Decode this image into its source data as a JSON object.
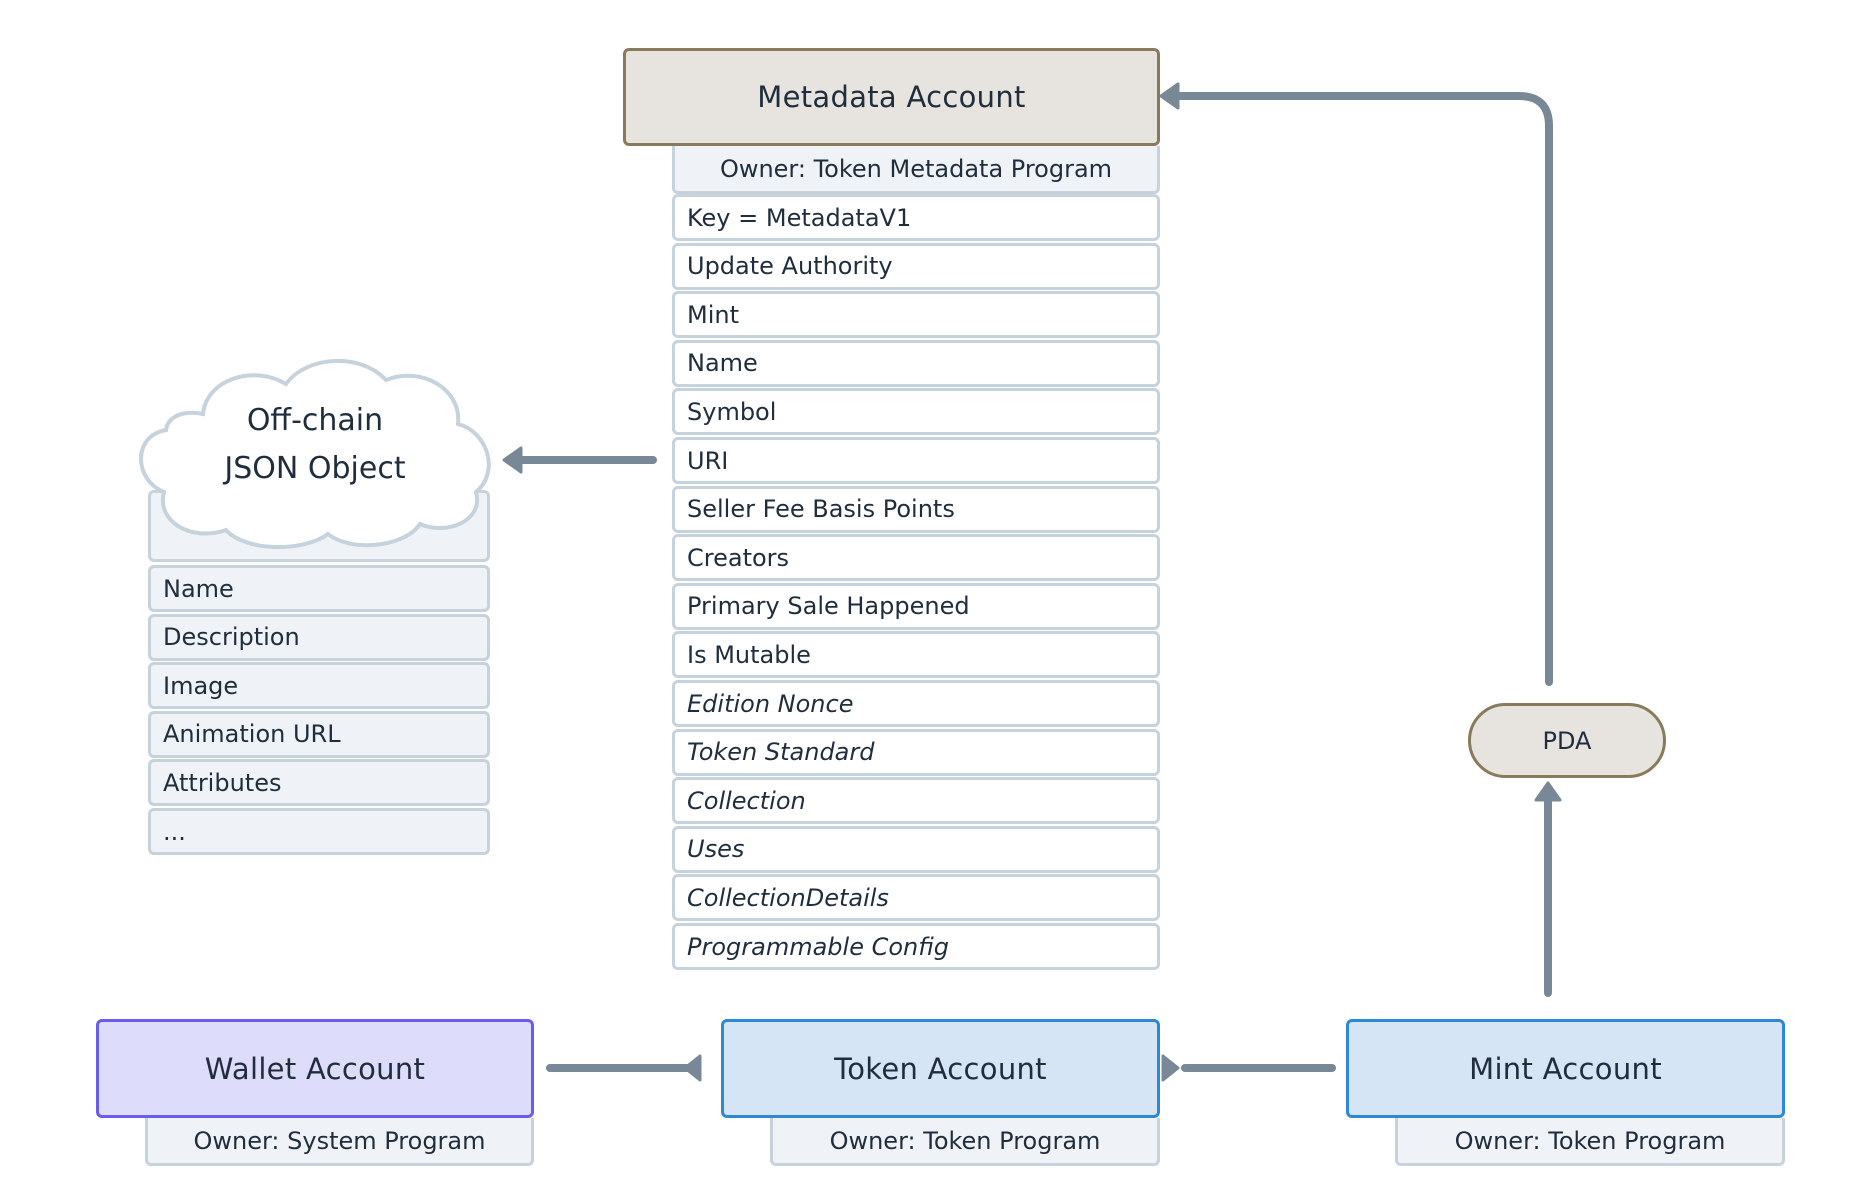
{
  "metadata_account": {
    "title": "Metadata Account",
    "owner": "Owner: Token Metadata Program",
    "fields": [
      {
        "label": "Key = MetadataV1",
        "italic": false
      },
      {
        "label": "Update Authority",
        "italic": false
      },
      {
        "label": "Mint",
        "italic": false
      },
      {
        "label": "Name",
        "italic": false
      },
      {
        "label": "Symbol",
        "italic": false
      },
      {
        "label": "URI",
        "italic": false
      },
      {
        "label": "Seller Fee Basis Points",
        "italic": false
      },
      {
        "label": "Creators",
        "italic": false
      },
      {
        "label": "Primary Sale Happened",
        "italic": false
      },
      {
        "label": "Is Mutable",
        "italic": false
      },
      {
        "label": "Edition Nonce",
        "italic": true
      },
      {
        "label": "Token Standard",
        "italic": true
      },
      {
        "label": "Collection",
        "italic": true
      },
      {
        "label": "Uses",
        "italic": true
      },
      {
        "label": "CollectionDetails",
        "italic": true
      },
      {
        "label": "Programmable Config",
        "italic": true
      }
    ]
  },
  "offchain_json": {
    "title_line1": "Off-chain",
    "title_line2": "JSON Object",
    "fields": [
      "Name",
      "Description",
      "Image",
      "Animation URL",
      "Attributes",
      "..."
    ]
  },
  "pda": {
    "label": "PDA"
  },
  "wallet_account": {
    "title": "Wallet Account",
    "owner": "Owner: System Program",
    "color": "#6b5cf0"
  },
  "token_account": {
    "title": "Token Account",
    "owner": "Owner: Token Program",
    "color": "#2e88d8"
  },
  "mint_account": {
    "title": "Mint Account",
    "owner": "Owner: Token Program",
    "color": "#2e88d8"
  },
  "connectors": [
    {
      "from": "mint_account",
      "to": "pda",
      "style": "arrow"
    },
    {
      "from": "pda",
      "to": "metadata_account",
      "style": "arrow"
    },
    {
      "from": "metadata_account.uri",
      "to": "offchain_json",
      "style": "arrow"
    },
    {
      "from": "mint_account",
      "to": "token_account",
      "style": "arrow"
    },
    {
      "from": "token_account",
      "to": "wallet_account",
      "style": "arrow"
    }
  ],
  "colors": {
    "connector": "#788896",
    "text": "#1f2d3d",
    "row_border": "#c6d2dc",
    "metadata_border": "#8a7a5c"
  }
}
